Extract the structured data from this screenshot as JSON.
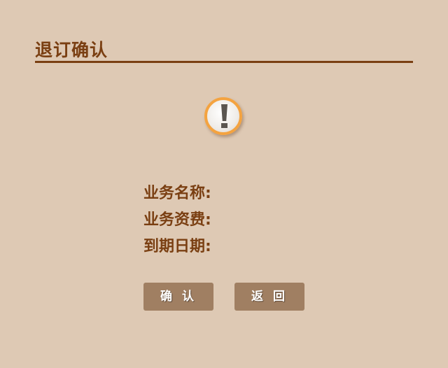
{
  "header": {
    "title": "退订确认"
  },
  "icon": "warning-exclamation-icon",
  "fields": [
    {
      "label": "业务名称:",
      "value": ""
    },
    {
      "label": "业务资费:",
      "value": ""
    },
    {
      "label": "到期日期:",
      "value": ""
    }
  ],
  "buttons": {
    "confirm": "确 认",
    "back": "返 回"
  }
}
